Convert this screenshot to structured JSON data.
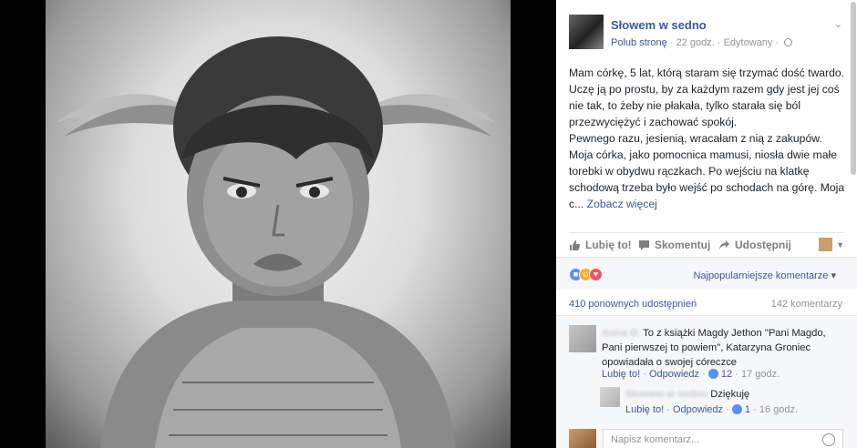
{
  "page": {
    "name": "Słowem w sedno",
    "like_link": "Polub stronę",
    "time": "22 godz.",
    "edited": "Edytowany",
    "sep": "·"
  },
  "post": {
    "p1": "Mam córkę, 5 lat, którą staram się trzymać dość twardo. Uczę ją po prostu, by za każdym razem gdy jest jej coś nie tak, to żeby nie płakała, tylko starała się ból przezwyciężyć i zachować spokój.",
    "p2": "Pewnego razu, jesienią, wracałam z nią z zakupów. Moja córka, jako pomocnica mamusi, niosła dwie małe torebki w obydwu rączkach. Po wejściu na klatkę schodową trzeba było wejść po schodach na górę. Moja c...",
    "see_more": "Zobacz więcej"
  },
  "actions": {
    "like": "Lubię to!",
    "comment": "Skomentuj",
    "share": "Udostępnij"
  },
  "reactions": {
    "icons": [
      "like-reaction",
      "haha-reaction",
      "love-reaction"
    ],
    "sort_label": "Najpopularniejsze komentarze",
    "sort_caret": "▾"
  },
  "counts": {
    "shares": "410 ponownych udostępnień",
    "comments": "142 komentarzy"
  },
  "comments": [
    {
      "author": "Anna D.",
      "text": "To z książki Magdy Jethon \"Pani Magdo, Pani pierwszej to powiem\", Katarzyna Groniec opowiadała o swojej córeczce",
      "like": "Lubię to!",
      "reply": "Odpowiedz",
      "likes": "12",
      "time": "17 godz."
    }
  ],
  "reply": {
    "author": "Słowem w sedno",
    "text": "Dziękuję",
    "like": "Lubię to!",
    "reply": "Odpowiedz",
    "likes": "1",
    "time": "16 godz."
  },
  "composer": {
    "placeholder": "Napisz komentarz..."
  },
  "colors": {
    "link_blue": "#3b5998",
    "reaction_like": "#5890ff",
    "reaction_haha": "#f7b125",
    "reaction_love": "#f25268"
  }
}
